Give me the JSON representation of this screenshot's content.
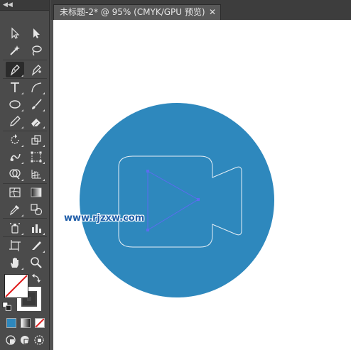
{
  "toolbar": {
    "collapse_label": "◀◀",
    "tools": [
      {
        "name": "selection-tool",
        "icon": "selection-arrow-icon"
      },
      {
        "name": "direct-selection-tool",
        "icon": "direct-selection-icon"
      },
      {
        "name": "magic-wand-tool",
        "icon": "magic-wand-icon"
      },
      {
        "name": "lasso-tool",
        "icon": "lasso-icon"
      },
      {
        "name": "pen-tool",
        "icon": "pen-icon"
      },
      {
        "name": "curvature-tool",
        "icon": "add-anchor-pen-icon"
      },
      {
        "name": "type-tool",
        "icon": "type-icon"
      },
      {
        "name": "line-segment-tool",
        "icon": "arc-icon"
      },
      {
        "name": "ellipse-tool",
        "icon": "ellipse-icon"
      },
      {
        "name": "paintbrush-tool",
        "icon": "paintbrush-icon"
      },
      {
        "name": "pencil-tool",
        "icon": "pencil-icon"
      },
      {
        "name": "eraser-tool",
        "icon": "eraser-icon"
      },
      {
        "name": "rotate-tool",
        "icon": "rotate-icon"
      },
      {
        "name": "scale-tool",
        "icon": "scale-icon"
      },
      {
        "name": "puppet-warp-tool",
        "icon": "warp-icon"
      },
      {
        "name": "free-transform-tool",
        "icon": "free-transform-icon"
      },
      {
        "name": "shape-builder-tool",
        "icon": "shape-builder-icon"
      },
      {
        "name": "perspective-grid-tool",
        "icon": "perspective-grid-icon"
      },
      {
        "name": "mesh-tool",
        "icon": "mesh-icon"
      },
      {
        "name": "gradient-tool",
        "icon": "gradient-icon"
      },
      {
        "name": "eyedropper-tool",
        "icon": "eyedropper-icon"
      },
      {
        "name": "blend-tool",
        "icon": "blend-icon"
      },
      {
        "name": "symbol-sprayer-tool",
        "icon": "symbol-sprayer-icon"
      },
      {
        "name": "column-graph-tool",
        "icon": "column-graph-icon"
      },
      {
        "name": "artboard-tool",
        "icon": "artboard-icon"
      },
      {
        "name": "slice-tool",
        "icon": "slice-icon"
      },
      {
        "name": "hand-tool",
        "icon": "hand-icon"
      },
      {
        "name": "zoom-tool",
        "icon": "zoom-icon"
      }
    ],
    "fill_color": "#ffffff",
    "stroke_color": "#ffffff",
    "none_color": "#e02020"
  },
  "document": {
    "tab_title": "未标题-2* @ 95% (CMYK/GPU 预览)",
    "close_label": "✕"
  },
  "artwork": {
    "circle_color": "#2e88bd",
    "outline_color": "#e8f0f6",
    "selection_color": "#5b6cf0"
  },
  "watermark": {
    "text": "www.rjzxw.com"
  }
}
